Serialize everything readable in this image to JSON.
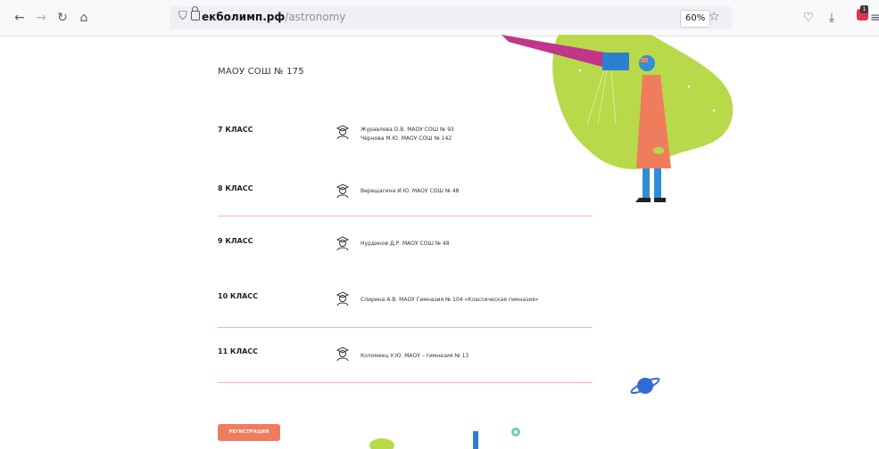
{
  "browser": {
    "url_domain": "екболимп.рф",
    "url_path": "/astronomy",
    "zoom_level": "60%",
    "extension_badge_count": "1"
  },
  "page": {
    "school_title": "МАОУ СОШ № 175",
    "grades": [
      {
        "label": "7 КЛАСС",
        "teachers": [
          "Журавлева О.В. МАОУ СОШ № 93",
          "Чернова М.Ю. МАОУ СОШ № 142"
        ]
      },
      {
        "label": "8 КЛАСС",
        "teachers": [
          "Верещагина И.Ю. МАОУ СОШ № 48"
        ]
      },
      {
        "label": "9 КЛАСС",
        "teachers": [
          "Нурдинов Д.Р. МАОУ СОШ № 48"
        ]
      },
      {
        "label": "10 КЛАСС",
        "teachers": [
          "Спирина А.В. МАОУ Гимназия № 104 «Классическая гимназия»"
        ]
      },
      {
        "label": "11 КЛАСС",
        "teachers": [
          "Коломеец У.Ю. МАОУ – гимназия № 13"
        ]
      }
    ],
    "register_label": "РЕГИСТРАЦИЯ"
  },
  "colors": {
    "accent": "#f07c5e",
    "divider": "#f1b9a4",
    "blob_green": "#b8d94a",
    "telescope_pink": "#c3358c",
    "person_coat": "#f07c5e",
    "planet_blue": "#2f6bd6"
  }
}
